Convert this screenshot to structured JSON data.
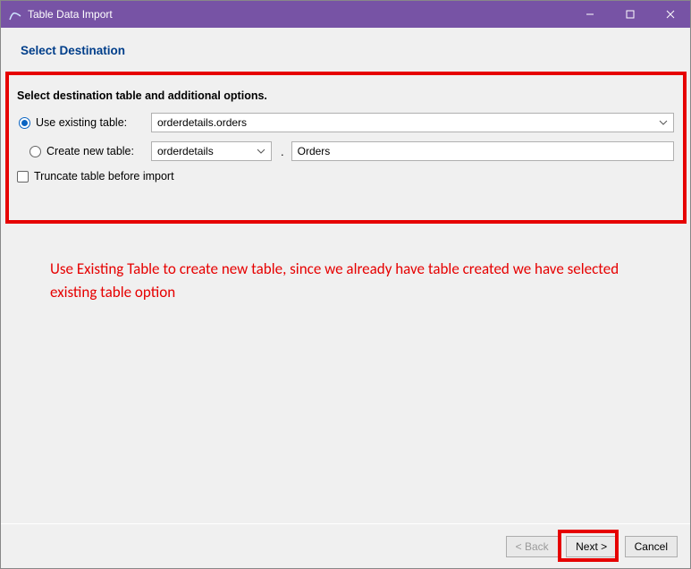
{
  "window": {
    "title": "Table Data Import"
  },
  "page": {
    "heading": "Select Destination"
  },
  "options": {
    "section_heading": "Select destination table and additional options.",
    "use_existing_label": "Use existing table:",
    "existing_table_value": "orderdetails.orders",
    "create_new_label": "Create new table:",
    "new_schema_value": "orderdetails",
    "schema_table_separator": ".",
    "new_table_value": "Orders",
    "truncate_label": "Truncate table before import"
  },
  "annotation": {
    "text": "Use Existing Table to create new table, since we already have table created we have selected existing table option"
  },
  "footer": {
    "back": "< Back",
    "next": "Next >",
    "cancel": "Cancel"
  }
}
